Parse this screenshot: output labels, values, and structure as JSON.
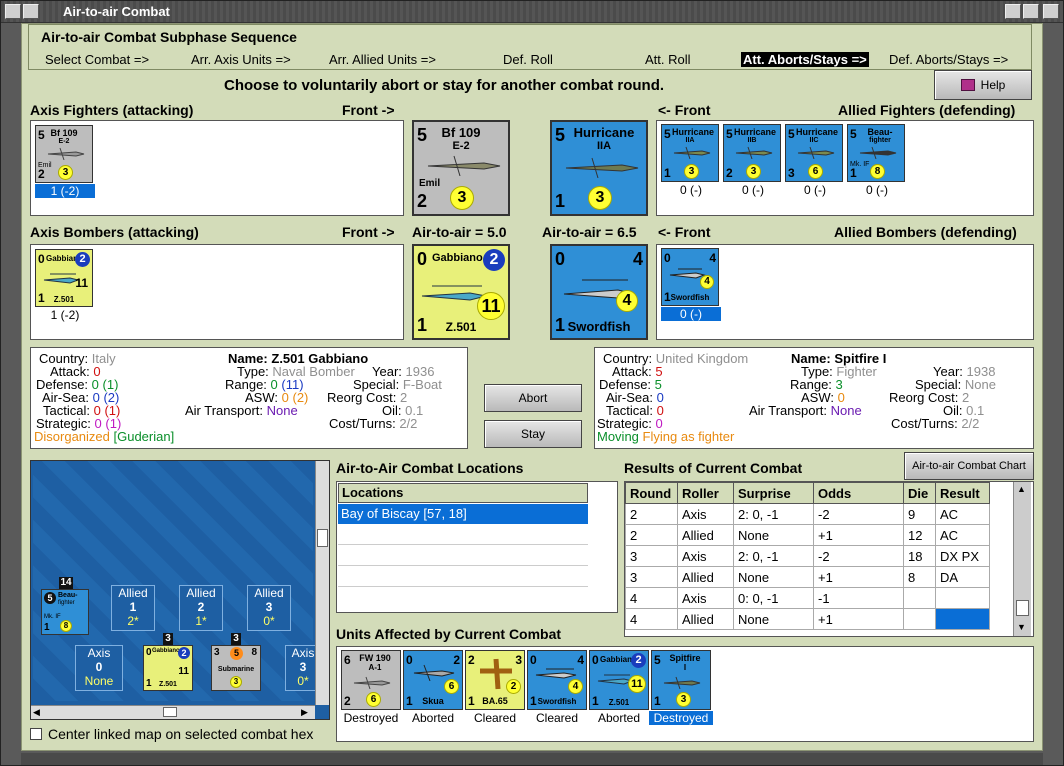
{
  "window": {
    "title": "Air-to-air Combat"
  },
  "sequence": {
    "title": "Air-to-air Combat Subphase Sequence",
    "steps": [
      "Select Combat =>",
      "Arr. Axis Units =>",
      "Arr. Allied Units =>",
      "Def. Roll",
      "Att. Roll",
      "Att. Aborts/Stays =>",
      "Def. Aborts/Stays =>"
    ],
    "active_index": 5
  },
  "prompt": "Choose to voluntarily abort or stay for another combat round.",
  "help_label": "Help",
  "sections": {
    "axis_fighters": "Axis Fighters (attacking)",
    "front_right": "Front ->",
    "front_left": "<- Front",
    "allied_fighters": "Allied Fighters (defending)",
    "axis_bombers": "Axis Bombers (attacking)",
    "axis_a2a": "Air-to-air = 5.0",
    "allied_a2a": "Air-to-air = 6.5",
    "allied_bombers": "Allied Bombers (defending)"
  },
  "axis_fighters": [
    {
      "name": "Bf 109",
      "sub": "E-2",
      "nick": "Emil",
      "tl": "5",
      "bl": "2",
      "circle": "3",
      "label": "1 (-2)"
    }
  ],
  "big_axis_fighter": {
    "name": "Bf 109",
    "sub": "E-2",
    "nick": "Emil",
    "tl": "5",
    "bl": "2",
    "circle": "3"
  },
  "big_allied_fighter": {
    "name": "Hurricane",
    "sub": "IIA",
    "tl": "5",
    "bl": "1",
    "circle": "3"
  },
  "allied_fighters": [
    {
      "name": "Hurricane",
      "sub": "IIA",
      "tl": "5",
      "bl": "1",
      "circle": "3",
      "label": "0 (-)"
    },
    {
      "name": "Hurricane",
      "sub": "IIB",
      "tl": "5",
      "bl": "2",
      "circle": "3",
      "label": "0 (-)"
    },
    {
      "name": "Hurricane",
      "sub": "IIC",
      "tl": "5",
      "bl": "3",
      "circle": "6",
      "label": "0 (-)"
    },
    {
      "name": "Beau-",
      "sub": "fighter",
      "nick": "Mk. IF",
      "tl": "5",
      "bl": "1",
      "circle": "8",
      "label": "0 (-)"
    }
  ],
  "axis_bombers": [
    {
      "name": "Gabbiano",
      "sub": "Z.501",
      "tl": "0",
      "tr": "2",
      "bl": "1",
      "big": "11",
      "label": "1 (-2)"
    }
  ],
  "big_axis_bomber": {
    "name": "Gabbiano",
    "sub": "Z.501",
    "tl": "0",
    "tr": "2",
    "bl": "1",
    "big": "11"
  },
  "big_allied_bomber": {
    "name": "Swordfish",
    "tl": "0",
    "tr": "4",
    "bl": "1",
    "circle": "4"
  },
  "allied_bombers": [
    {
      "name": "Swordfish",
      "tl": "0",
      "tr": "4",
      "bl": "1",
      "circle": "4",
      "label": "0 (-)"
    }
  ],
  "left_info": {
    "country_label": "Country:",
    "country": "Italy",
    "attack_label": "Attack:",
    "attack": "0",
    "defense_label": "Defense:",
    "defense": "0",
    "defense_mod": "(1)",
    "airsea_label": "Air-Sea:",
    "airsea": "0",
    "airsea_mod": "(2)",
    "tactical_label": "Tactical:",
    "tactical": "0",
    "tactical_mod": "(1)",
    "strategic_label": "Strategic:",
    "strategic": "0",
    "strategic_mod": "(1)",
    "name_label": "Name:",
    "name": "Z.501 Gabbiano",
    "type_label": "Type:",
    "type": "Naval Bomber",
    "year_label": "Year:",
    "year": "1936",
    "range_label": "Range:",
    "range": "0",
    "range_mod": "(11)",
    "special_label": "Special:",
    "special": "F-Boat",
    "asw_label": "ASW:",
    "asw": "0",
    "asw_mod": "(2)",
    "reorg_label": "Reorg Cost:",
    "reorg": "2",
    "transport_label": "Air Transport:",
    "transport": "None",
    "oil_label": "Oil:",
    "oil": "0.1",
    "cost_label": "Cost/Turns:",
    "cost": "2/2",
    "status1": "Disorganized",
    "status2": "[Guderian]"
  },
  "right_info": {
    "country_label": "Country:",
    "country": "United Kingdom",
    "attack_label": "Attack:",
    "attack": "5",
    "defense_label": "Defense:",
    "defense": "5",
    "airsea_label": "Air-Sea:",
    "airsea": "0",
    "tactical_label": "Tactical:",
    "tactical": "0",
    "strategic_label": "Strategic:",
    "strategic": "0",
    "name_label": "Name:",
    "name": "Spitfire I",
    "type_label": "Type:",
    "type": "Fighter",
    "year_label": "Year:",
    "year": "1938",
    "range_label": "Range:",
    "range": "3",
    "special_label": "Special:",
    "special": "None",
    "asw_label": "ASW:",
    "asw": "0",
    "reorg_label": "Reorg Cost:",
    "reorg": "2",
    "transport_label": "Air Transport:",
    "transport": "None",
    "oil_label": "Oil:",
    "oil": "0.1",
    "cost_label": "Cost/Turns:",
    "cost": "2/2",
    "status1": "Moving",
    "status2": "Flying as fighter"
  },
  "abort_label": "Abort",
  "stay_label": "Stay",
  "map": {
    "boxes": [
      {
        "side": "Allied",
        "num": "1",
        "val": "2*"
      },
      {
        "side": "Allied",
        "num": "2",
        "val": "1*"
      },
      {
        "side": "Allied",
        "num": "3",
        "val": "0*"
      },
      {
        "side": "Axis",
        "num": "0",
        "val": "None"
      },
      {
        "side": "Axis",
        "num": "3",
        "val": "0*"
      }
    ],
    "stack_counts": [
      "14",
      "3",
      "3"
    ],
    "counters": [
      {
        "name": "Beau-",
        "sub": "fighter",
        "nick": "Mk. IF",
        "tl": "5",
        "bl": "1",
        "circle": "8"
      },
      {
        "name": "Gabbiano",
        "sub": "Z.501",
        "tl": "0",
        "tr": "2",
        "bl": "1",
        "big": "11"
      },
      {
        "name": "Submarine",
        "tl": "3",
        "tr": "8",
        "mid": "5",
        "circle": "3"
      }
    ],
    "center_label": "Center linked map on selected combat hex"
  },
  "locations": {
    "title": "Air-to-Air Combat Locations",
    "header": "Locations",
    "rows": [
      "Bay of Biscay [57, 18]"
    ]
  },
  "results": {
    "title": "Results of Current Combat",
    "chart_button": "Air-to-air Combat Chart",
    "columns": [
      "Round",
      "Roller",
      "Surprise",
      "Odds",
      "Die",
      "Result"
    ],
    "rows": [
      [
        "2",
        "Axis",
        "2: 0, -1",
        "-2",
        "9",
        "AC"
      ],
      [
        "2",
        "Allied",
        "None",
        "+1",
        "12",
        "AC"
      ],
      [
        "3",
        "Axis",
        "2: 0, -1",
        "-2",
        "18",
        "DX PX"
      ],
      [
        "3",
        "Allied",
        "None",
        "+1",
        "8",
        "DA"
      ],
      [
        "4",
        "Axis",
        "0: 0, -1",
        "-1",
        "",
        ""
      ],
      [
        "4",
        "Allied",
        "None",
        "+1",
        "",
        ""
      ]
    ]
  },
  "affected": {
    "title": "Units Affected by Current Combat",
    "units": [
      {
        "name": "FW 190",
        "sub": "A-1",
        "tl": "6",
        "bl": "2",
        "circle": "6",
        "label": "Destroyed"
      },
      {
        "name": "Skua",
        "tl": "0",
        "tr": "2",
        "bl": "1",
        "circle": "6",
        "label": "Aborted"
      },
      {
        "name": "BA.65",
        "tl": "2",
        "tr": "3",
        "bl": "1",
        "circle": "2",
        "label": "Cleared"
      },
      {
        "name": "Swordfish",
        "tl": "0",
        "tr": "4",
        "bl": "1",
        "circle": "4",
        "label": "Cleared"
      },
      {
        "name": "Gabbiano",
        "sub": "Z.501",
        "tl": "0",
        "tr": "2",
        "bl": "1",
        "big": "11",
        "label": "Aborted"
      },
      {
        "name": "Spitfire",
        "sub": "I",
        "tl": "5",
        "bl": "1",
        "circle": "3",
        "label": "Destroyed"
      }
    ]
  },
  "colors": {
    "panel": "#d3dcb9",
    "selection": "#0a6ed6",
    "axis_counter": "#bdbdbd",
    "italy_counter": "#e8f07a",
    "allied_counter": "#2f8fd6"
  }
}
